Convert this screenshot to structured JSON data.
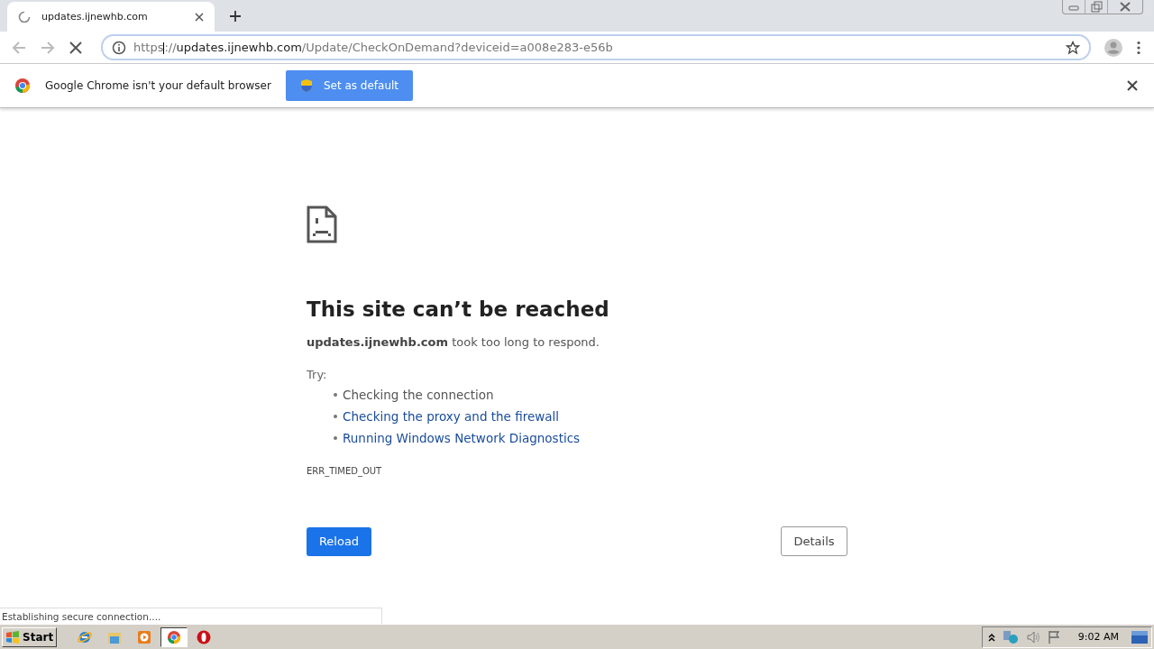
{
  "tab": {
    "title": "updates.ijnewhb.com",
    "loading": true
  },
  "address_bar": {
    "scheme": "https",
    "separator": "://",
    "host": "updates.ijnewhb.com",
    "path": "/Update/CheckOnDemand?deviceid=a008e283-e56b"
  },
  "infobar": {
    "message": "Google Chrome isn't your default browser",
    "button": "Set as default"
  },
  "error": {
    "title": "This site can’t be reached",
    "description": "**updates.ijnewhb.com** took too long to respond.",
    "try_label": "Try:",
    "suggestions": [
      {
        "text": "Checking the connection",
        "kind": "text"
      },
      {
        "text": "Checking the proxy and the firewall",
        "kind": "link"
      },
      {
        "text": "Running Windows Network Diagnostics",
        "kind": "link"
      }
    ],
    "code": "ERR_TIMED_OUT",
    "reload_button": "Reload",
    "details_button": "Details"
  },
  "status_bubble": "Establishing secure connection....",
  "taskbar": {
    "start": "Start",
    "apps": [
      {
        "kind": "ie",
        "selected": false
      },
      {
        "kind": "explorer",
        "selected": false
      },
      {
        "kind": "media",
        "selected": false
      },
      {
        "kind": "chrome",
        "selected": true
      },
      {
        "kind": "opera",
        "selected": false
      }
    ],
    "clock": "9:02 AM"
  }
}
